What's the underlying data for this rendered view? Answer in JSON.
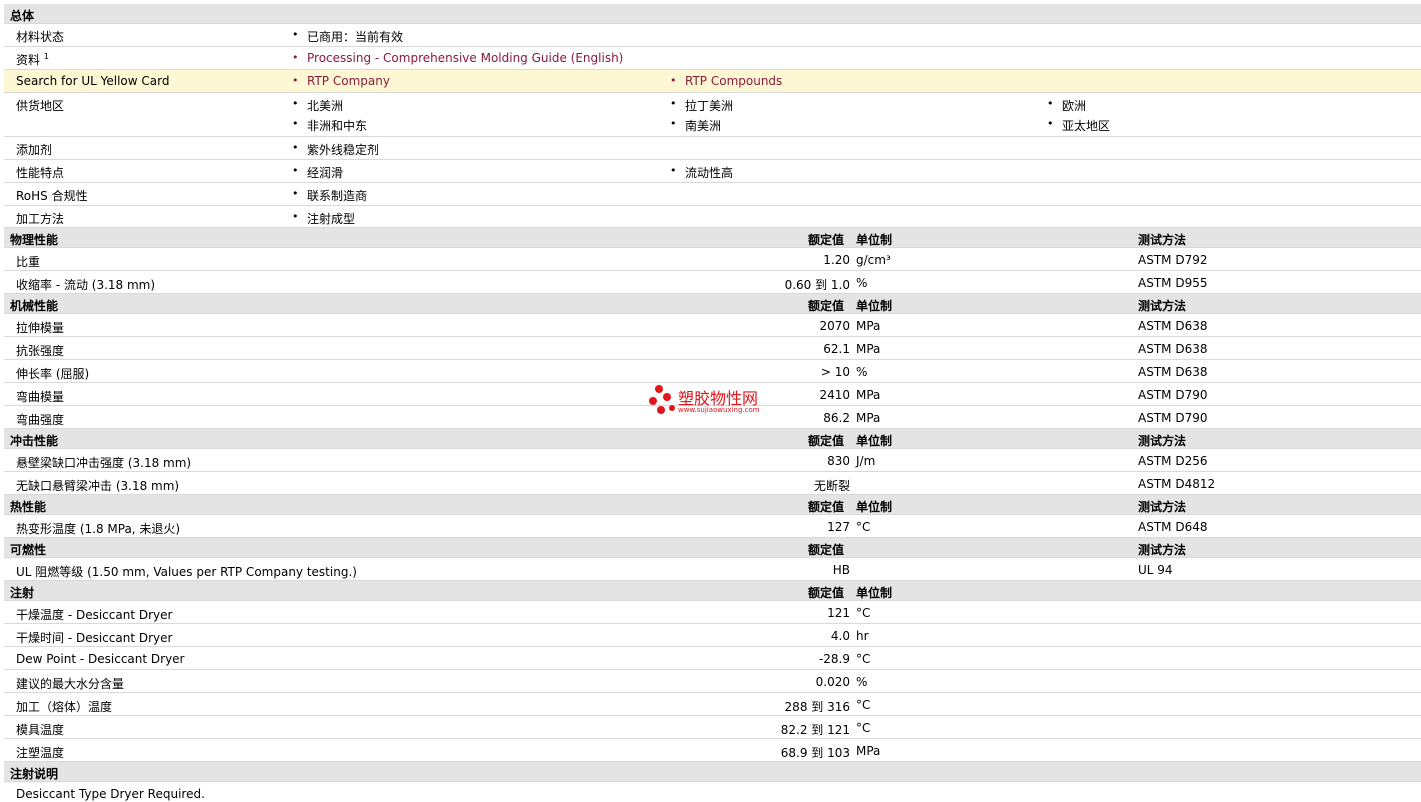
{
  "general": {
    "title": "总体",
    "status_label": "材料状态",
    "status_value": "已商用：当前有效",
    "doc_label": "资料",
    "doc_sup": "1",
    "doc_link": "Processing - Comprehensive Molding Guide (English)",
    "ul_label": "Search for UL Yellow Card",
    "ul_link1": "RTP Company",
    "ul_link2": "RTP Compounds",
    "region_label": "供货地区",
    "regions": [
      "北美洲",
      "拉丁美洲",
      "欧洲",
      "非洲和中东",
      "南美洲",
      "亚太地区"
    ],
    "additive_label": "添加剂",
    "additive_value": "紫外线稳定剂",
    "feature_label": "性能特点",
    "features": [
      "经润滑",
      "流动性高"
    ],
    "rohs_label": "RoHS 合规性",
    "rohs_value": "联系制造商",
    "process_label": "加工方法",
    "process_value": "注射成型"
  },
  "headers": {
    "rated": "额定值",
    "unit": "单位制",
    "method": "测试方法"
  },
  "physical": {
    "title": "物理性能",
    "rows": [
      {
        "name": "比重",
        "value": "1.20",
        "unit": "g/cm³",
        "method": "ASTM D792"
      },
      {
        "name": "收缩率  - 流动  (3.18 mm)",
        "value": "0.60 到  1.0",
        "unit": "%",
        "method": "ASTM D955"
      }
    ]
  },
  "mechanical": {
    "title": "机械性能",
    "rows": [
      {
        "name": "拉伸模量",
        "value": "2070",
        "unit": "MPa",
        "method": "ASTM D638"
      },
      {
        "name": "抗张强度",
        "value": "62.1",
        "unit": "MPa",
        "method": "ASTM D638"
      },
      {
        "name": "伸长率  (屈服)",
        "value": "> 10",
        "unit": "%",
        "method": "ASTM D638"
      },
      {
        "name": "弯曲模量",
        "value": "2410",
        "unit": "MPa",
        "method": "ASTM D790"
      },
      {
        "name": "弯曲强度",
        "value": "86.2",
        "unit": "MPa",
        "method": "ASTM D790"
      }
    ]
  },
  "impact": {
    "title": "冲击性能",
    "rows": [
      {
        "name": "悬壁梁缺口冲击强度  (3.18 mm)",
        "value": "830",
        "unit": "J/m",
        "method": "ASTM D256"
      },
      {
        "name": "无缺口悬臂梁冲击  (3.18 mm)",
        "value": "无断裂",
        "unit": "",
        "method": "ASTM D4812"
      }
    ]
  },
  "thermal": {
    "title": "热性能",
    "rows": [
      {
        "name": "热变形温度  (1.8 MPa, 未退火)",
        "value": "127",
        "unit": "°C",
        "method": "ASTM D648"
      }
    ]
  },
  "flammability": {
    "title": "可燃性",
    "rows": [
      {
        "name": "UL 阻燃等级  (1.50 mm, Values per RTP Company testing.)",
        "value": "HB",
        "unit": "",
        "method": "UL 94"
      }
    ]
  },
  "injection": {
    "title": "注射",
    "rows": [
      {
        "name": "干燥温度  - Desiccant Dryer",
        "value": "121",
        "unit": "°C"
      },
      {
        "name": "干燥时间  - Desiccant Dryer",
        "value": "4.0",
        "unit": "hr"
      },
      {
        "name": "Dew Point - Desiccant Dryer",
        "value": "-28.9",
        "unit": "°C"
      },
      {
        "name": "建议的最大水分含量",
        "value": "0.020",
        "unit": "%"
      },
      {
        "name": "加工（熔体）温度",
        "value": "288 到  316",
        "unit": "°C"
      },
      {
        "name": "模具温度",
        "value": "82.2 到  121",
        "unit": "°C"
      },
      {
        "name": "注塑温度",
        "value": "68.9 到  103",
        "unit": "MPa"
      }
    ]
  },
  "notes": {
    "title": "注射说明",
    "text": "Desiccant Type Dryer Required."
  },
  "watermark": {
    "name": "塑胶物性网",
    "url": "www.sujiaowuxing.com"
  }
}
